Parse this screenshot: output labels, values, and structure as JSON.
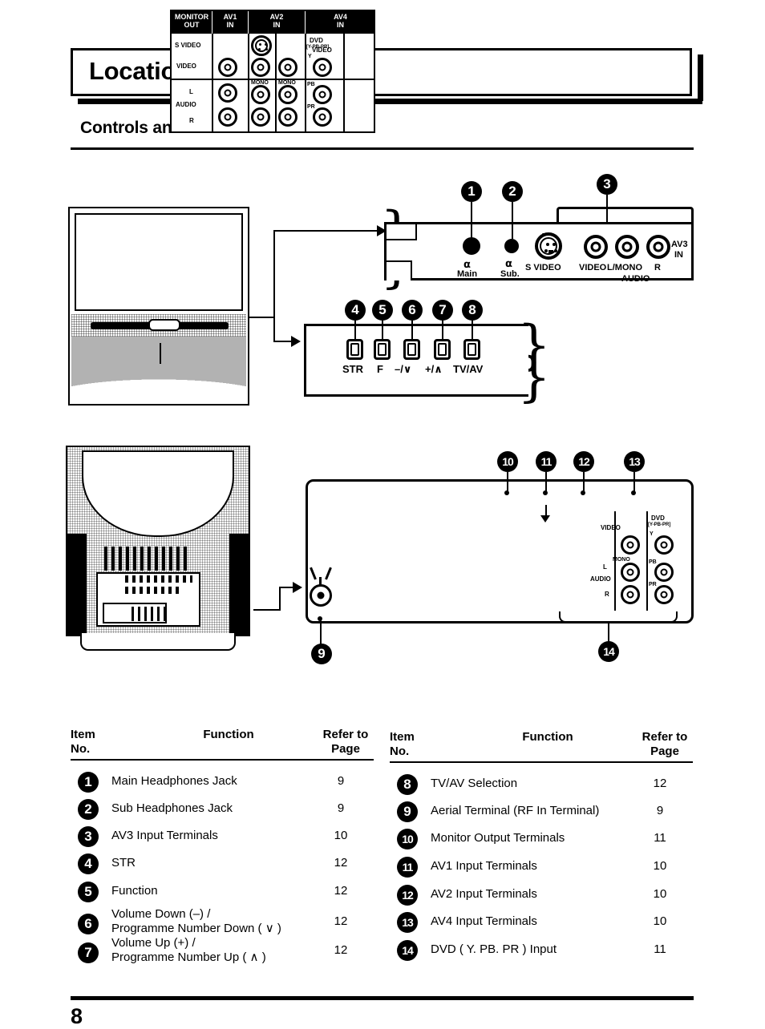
{
  "page": {
    "title": "Location of Controls",
    "subtitle": "Controls and Terminals on the TV",
    "page_number": "8"
  },
  "diagram_top": {
    "av3_panel": {
      "group_label_line1": "AV3",
      "group_label_line2": "IN",
      "jacks": [
        {
          "callout": "1",
          "label": "Main",
          "icon": "headphones-main-icon"
        },
        {
          "callout": "2",
          "label": "Sub.",
          "icon": "headphones-sub-icon"
        }
      ],
      "terminals": [
        {
          "label": "S VIDEO",
          "type": "s-video"
        },
        {
          "label": "VIDEO",
          "type": "rca"
        },
        {
          "label": "L/MONO",
          "type": "rca"
        },
        {
          "label": "R",
          "type": "rca"
        }
      ],
      "audio_label": "AUDIO",
      "callout_group": "3"
    },
    "button_bar": {
      "buttons": [
        {
          "callout": "4",
          "label": "STR"
        },
        {
          "callout": "5",
          "label": "F"
        },
        {
          "callout": "6",
          "label": "–/∨"
        },
        {
          "callout": "7",
          "label": "+/∧"
        },
        {
          "callout": "8",
          "label": "TV/AV"
        }
      ]
    }
  },
  "diagram_bottom": {
    "aerial": {
      "callout": "9",
      "icon": "aerial-terminal-icon"
    },
    "groups": [
      {
        "callout": "10",
        "line1": "MONITOR",
        "line2": "OUT"
      },
      {
        "callout": "11",
        "line1": "AV1",
        "line2": "IN"
      },
      {
        "callout": "12",
        "line1": "AV2",
        "line2": "IN"
      },
      {
        "callout": "13",
        "line1": "AV4",
        "line2": "IN"
      }
    ],
    "row_labels": {
      "svideo": "S VIDEO",
      "video": "VIDEO",
      "audio": "AUDIO",
      "left": "L",
      "right": "R",
      "mono": "MONO"
    },
    "dvd_label": "DVD",
    "dvd_sub": "[Y-PB-PR]",
    "dvd_rows": [
      "Y",
      "PB",
      "PR"
    ],
    "dvd_callout": "14"
  },
  "tables": {
    "headers": {
      "item_line1": "Item",
      "item_line2": "No.",
      "function": "Function",
      "refer_line1": "Refer to",
      "refer_line2": "Page"
    },
    "left_rows": [
      {
        "no": "1",
        "function": "Main Headphones Jack",
        "function2": "",
        "page": "9"
      },
      {
        "no": "2",
        "function": "Sub Headphones Jack",
        "function2": "",
        "page": "9"
      },
      {
        "no": "3",
        "function": "AV3 Input Terminals",
        "function2": "",
        "page": "10"
      },
      {
        "no": "4",
        "function": "STR",
        "function2": "",
        "page": "12"
      },
      {
        "no": "5",
        "function": "Function",
        "function2": "",
        "page": "12"
      },
      {
        "no": "6",
        "function": "Volume Down (–) /",
        "function2": "Programme Number Down ( ∨ )",
        "page": "12"
      },
      {
        "no": "7",
        "function": "Volume Up (+) /",
        "function2": "Programme Number Up ( ∧ )",
        "page": "12"
      }
    ],
    "right_rows": [
      {
        "no": "8",
        "function": "TV/AV Selection",
        "function2": "",
        "page": "12"
      },
      {
        "no": "9",
        "function": "Aerial Terminal (RF In Terminal)",
        "function2": "",
        "page": "9"
      },
      {
        "no": "10",
        "function": "Monitor Output Terminals",
        "function2": "",
        "page": "11"
      },
      {
        "no": "11",
        "function": "AV1 Input Terminals",
        "function2": "",
        "page": "10"
      },
      {
        "no": "12",
        "function": "AV2 Input Terminals",
        "function2": "",
        "page": "10"
      },
      {
        "no": "13",
        "function": "AV4 Input Terminals",
        "function2": "",
        "page": "10"
      },
      {
        "no": "14",
        "function": "DVD ( Y. PB. PR ) Input",
        "function2": "",
        "page": "11"
      }
    ]
  }
}
